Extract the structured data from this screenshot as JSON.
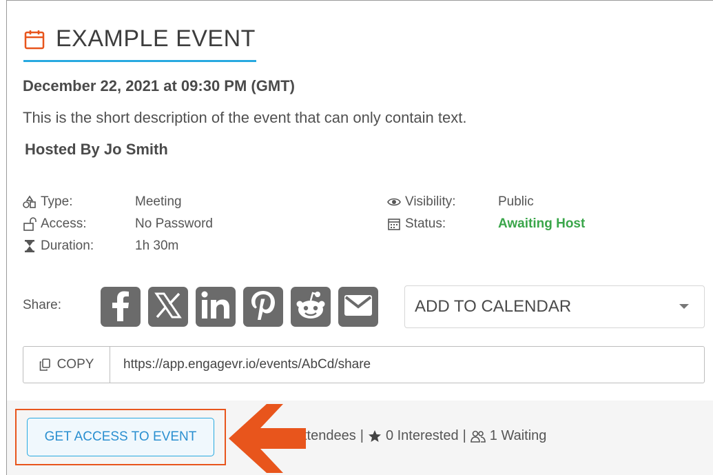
{
  "event": {
    "title": "EXAMPLE EVENT",
    "datetime": "December 22, 2021 at 09:30 PM (GMT)",
    "description": "This is the short description of the event that can only contain text.",
    "host": "Hosted By Jo Smith"
  },
  "details": {
    "type_label": "Type:",
    "type_value": "Meeting",
    "access_label": "Access:",
    "access_value": "No Password",
    "duration_label": "Duration:",
    "duration_value": "1h 30m",
    "visibility_label": "Visibility:",
    "visibility_value": "Public",
    "status_label": "Status:",
    "status_value": "Awaiting Host"
  },
  "share": {
    "label": "Share:",
    "icons": [
      "facebook-icon",
      "x-icon",
      "linkedin-icon",
      "pinterest-icon",
      "reddit-icon",
      "email-icon"
    ],
    "calendar_label": "ADD TO CALENDAR"
  },
  "link": {
    "copy_label": "COPY",
    "url": "https://app.engagevr.io/events/AbCd/share"
  },
  "footer": {
    "access_button": "GET ACCESS TO EVENT",
    "attendees_text": "ttendees",
    "interested_text": "0 Interested",
    "waiting_text": "1 Waiting",
    "separator": "|"
  },
  "colors": {
    "accent_blue": "#27a9e0",
    "status_green": "#3aa64a",
    "highlight_orange": "#e8551c",
    "social_gray": "#6b6b6b"
  }
}
